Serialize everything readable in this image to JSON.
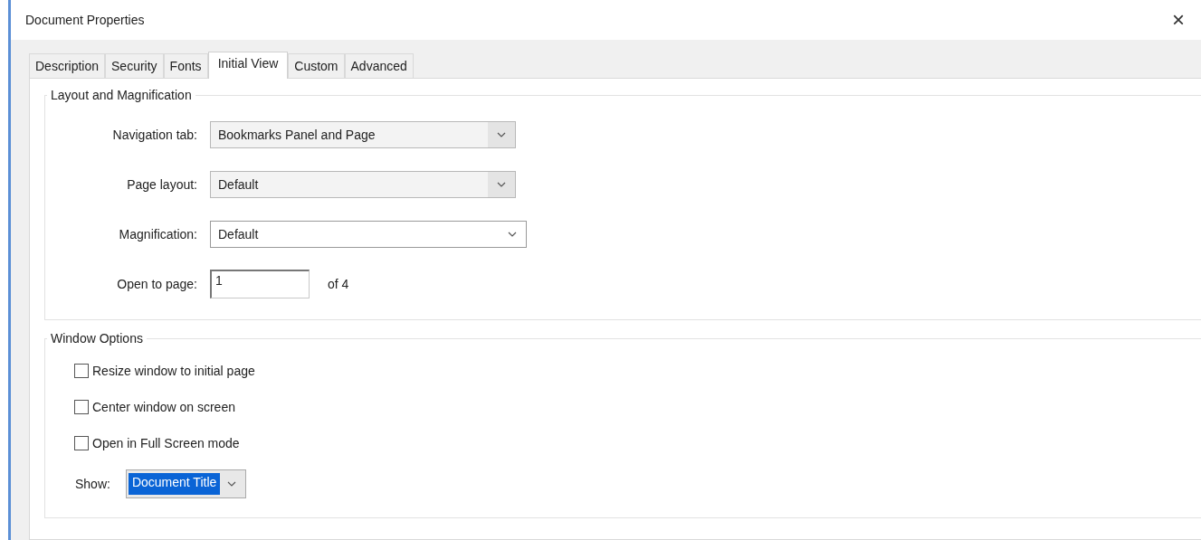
{
  "window": {
    "title": "Document Properties",
    "close": "×"
  },
  "tabs": [
    {
      "label": "Description",
      "selected": false
    },
    {
      "label": "Security",
      "selected": false
    },
    {
      "label": "Fonts",
      "selected": false
    },
    {
      "label": "Initial View",
      "selected": true
    },
    {
      "label": "Custom",
      "selected": false
    },
    {
      "label": "Advanced",
      "selected": false
    }
  ],
  "layout_group": {
    "title": "Layout and Magnification",
    "fields": [
      {
        "kind": "dropdown",
        "label": "Navigation tab:",
        "value": "Bookmarks Panel and Page"
      },
      {
        "kind": "dropdown",
        "label": "Page layout:",
        "value": "Default"
      },
      {
        "kind": "combo",
        "label": "Magnification:",
        "value": "Default"
      },
      {
        "kind": "input",
        "label": "Open to page:",
        "value": "1",
        "suffix": "of 4"
      }
    ]
  },
  "window_group": {
    "title": "Window Options",
    "checkboxes": [
      {
        "label": "Resize window to initial page",
        "checked": false
      },
      {
        "label": "Center window on screen",
        "checked": false
      },
      {
        "label": "Open in Full Screen mode",
        "checked": false
      }
    ],
    "show": {
      "label": "Show:",
      "value": "Document Title",
      "highlighted": true
    }
  }
}
